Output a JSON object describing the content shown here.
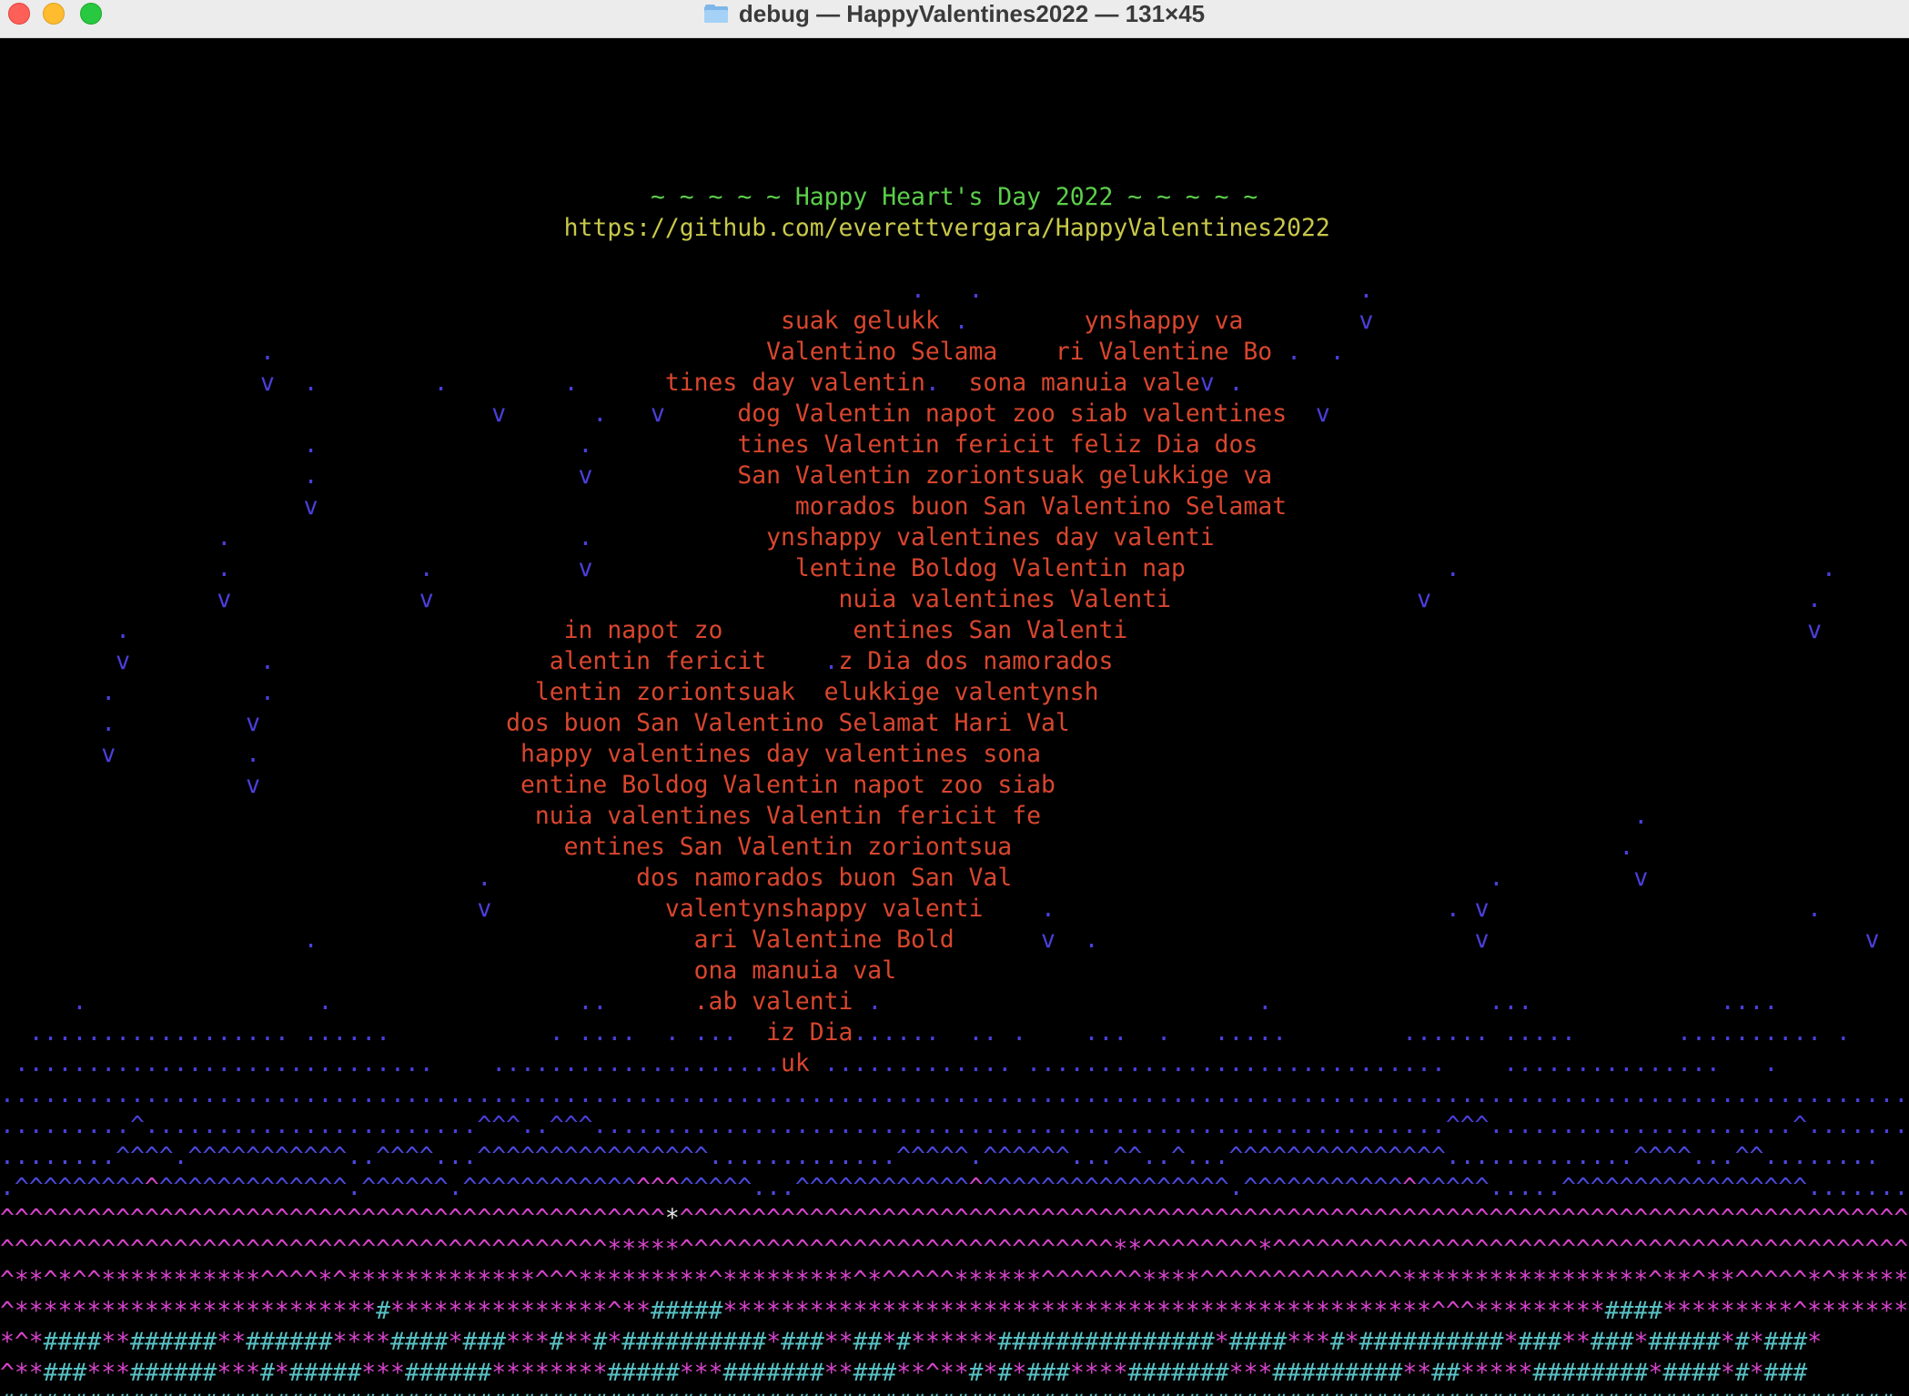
{
  "window": {
    "title": "debug — HappyValentines2022 — 131×45",
    "folder_icon": "folder-icon"
  },
  "colors": {
    "title": "#5ccf4a",
    "url": "#c8c84a",
    "heart": "#d9462e",
    "rain": "#4b3fdc",
    "caret": "#4d49de",
    "pink": "#d744cc",
    "hash": "#58c0c4",
    "white": "#e6e6e6"
  },
  "terminal": {
    "lines": [
      "",
      "",
      "",
      "",
      [
        [
          "                                             ~ ~ ~ ~ ~ Happy Heart's Day 2022 ~ ~ ~ ~ ~",
          "title"
        ]
      ],
      [
        [
          "                                       https://github.com/everettvergara/HappyValentines2022",
          "url"
        ]
      ],
      "",
      [
        [
          "                                                               .   .                          .",
          "rain"
        ]
      ],
      [
        [
          "                                                      suak gelukk ",
          "heart"
        ],
        [
          ".",
          "rain"
        ],
        [
          "        ynshappy va        ",
          "heart"
        ],
        [
          "v",
          "rain"
        ]
      ],
      [
        [
          "                  .",
          "rain"
        ],
        [
          "                                  Valentino Selama    ri Valentine Bo",
          "heart"
        ],
        [
          " .  .",
          "rain"
        ]
      ],
      [
        [
          "                  v  .        .        .",
          "rain"
        ],
        [
          "      tines day valentin",
          "heart"
        ],
        [
          ".",
          "rain"
        ],
        [
          "  sona manuia vale",
          "heart"
        ],
        [
          "v .",
          "rain"
        ]
      ],
      [
        [
          "                                  v      .   v",
          "rain"
        ],
        [
          "     dog Valentin napot zoo siab valentines",
          "heart"
        ],
        [
          "  v",
          "rain"
        ]
      ],
      [
        [
          "                     .                  .",
          "rain"
        ],
        [
          "          tines Valentin fericit feliz Dia dos",
          "heart"
        ]
      ],
      [
        [
          "                     .                  v",
          "rain"
        ],
        [
          "          San Valentin zoriontsuak gelukkige va",
          "heart"
        ]
      ],
      [
        [
          "                     v",
          "rain"
        ],
        [
          "                                 morados buon San Valentino Selamat",
          "heart"
        ]
      ],
      [
        [
          "               .                        .",
          "rain"
        ],
        [
          "            ynshappy valentines day valenti",
          "heart"
        ]
      ],
      [
        [
          "               .             .          v",
          "rain"
        ],
        [
          "              lentine Boldog Valentin nap",
          "heart"
        ],
        [
          "                  .                         .",
          "rain"
        ]
      ],
      [
        [
          "               v             v",
          "rain"
        ],
        [
          "                            nuia valentines Valenti",
          "heart"
        ],
        [
          "                 v                          .",
          "rain"
        ]
      ],
      [
        [
          "        .",
          "rain"
        ],
        [
          "                              in napot zo         entines San Valenti",
          "heart"
        ],
        [
          "                                               v",
          "rain"
        ]
      ],
      [
        [
          "        v         .",
          "rain"
        ],
        [
          "                   alentin fericit    ",
          "heart"
        ],
        [
          ".",
          "rain"
        ],
        [
          "z Dia dos namorados",
          "heart"
        ]
      ],
      [
        [
          "       .          .",
          "rain"
        ],
        [
          "                  lentin zoriontsuak  elukkige valentynsh",
          "heart"
        ]
      ],
      [
        [
          "       .         v",
          "rain"
        ],
        [
          "                 dos buon San Valentino Selamat Hari Val",
          "heart"
        ]
      ],
      [
        [
          "       v         .",
          "rain"
        ],
        [
          "                  happy valentines day valentines sona",
          "heart"
        ]
      ],
      [
        [
          "                 v",
          "rain"
        ],
        [
          "                  entine Boldog Valentin napot zoo siab",
          "heart"
        ]
      ],
      [
        [
          "                                     nuia valentines Valentin fericit fe",
          "heart"
        ],
        [
          "                                         .",
          "rain"
        ]
      ],
      [
        [
          "                                       entines San Valentin zoriontsua",
          "heart"
        ],
        [
          "                                          .",
          "rain"
        ]
      ],
      [
        [
          "                                 .",
          "rain"
        ],
        [
          "          dos namorados buon San Val",
          "heart"
        ],
        [
          "                                 .         v",
          "rain"
        ]
      ],
      [
        [
          "                                 v",
          "rain"
        ],
        [
          "            valentynshappy valenti",
          "heart"
        ],
        [
          "    .                           . v                      .",
          "rain"
        ]
      ],
      [
        [
          "                     .",
          "rain"
        ],
        [
          "                          ari Valentine Bold",
          "heart"
        ],
        [
          "      v  .                          v                          v",
          "rain"
        ]
      ],
      [
        [
          "                                                ona manuia val",
          "heart"
        ]
      ],
      [
        [
          "     .                .                 ..",
          "rain"
        ],
        [
          "      ",
          "rain"
        ],
        [
          ".ab valenti",
          "heart"
        ],
        [
          " .",
          "rain"
        ],
        [
          "                          .               ...             ....",
          "rain"
        ]
      ],
      [
        [
          "  .................. ......           . ....  . ...",
          "rain"
        ],
        [
          "  iz Dia",
          "heart"
        ],
        [
          "......  .. .    ...  .   .....        ...... .....       .......... .",
          "rain"
        ]
      ],
      [
        [
          " .............................    ....................",
          "rain"
        ],
        [
          "uk",
          "heart"
        ],
        [
          " ............. .............................    ...............   .",
          "rain"
        ]
      ],
      [
        [
          ".......................................................................................................................................",
          "rain"
        ]
      ],
      [
        [
          ".........^.......................^^^..^^^...........................................................^^^.....................^..............",
          "rain"
        ]
      ],
      [
        [
          "........^^^^.^^^^^^^^^^^..^^^^...^^^^^^^^^^^^^^^^.............^^^^^.^^^^^^...^^..^...^^^^^^^^^^^^^^^.............^^^^...^^........",
          "caret"
        ]
      ],
      [
        [
          ".^^^^^^^^^",
          "caret"
        ],
        [
          "^",
          "pink"
        ],
        [
          "^^^^^^^^^^^^^",
          "caret"
        ],
        [
          ".^^^^^^.^^^^^^^^^^^^",
          "caret"
        ],
        [
          "^^^",
          "pink"
        ],
        [
          "^^^^^...",
          "caret"
        ],
        [
          "^^^^^^^^^^^^",
          "caret"
        ],
        [
          "^",
          "pink"
        ],
        [
          "^^^^^^^^^^^^^^^^^.^^^^^^^^^^^",
          "caret"
        ],
        [
          "^",
          "pink"
        ],
        [
          "^^^^^.....^^^^^^^^^^^^^^^^^.......",
          "caret"
        ]
      ],
      [
        [
          "^^^^^^^^^^^^^^^^^^^^^^^^^^^^^^^^^^^^^^^^^^^^^^",
          "pink"
        ],
        [
          "*",
          "white"
        ],
        [
          "^^^^^^^^^^^^^^^^^^^^^^^^^^^^^^^^^^^^^^^^^^^^^^^^^^^^^^^^^^^^^^^^^^^^^^^^^^^^^^^^^^^^^^^",
          "pink"
        ]
      ],
      [
        [
          "^^^^^^^^^^^^^^^^^^^^^^^^^^^^^^^^^^^^^^^^^^",
          "pink"
        ],
        [
          "*****",
          "pink"
        ],
        [
          "^^^^^^^^^^^^^^^^^^^^^^^^^^^^^^**^^^^^^^^*^^^^^^^^^^^^^^^^^^^^^^^^^^^^^^^^^^^^^^^^^^^^^^^^^^^^^^",
          "pink"
        ]
      ],
      [
        [
          "^**^*^^***********^^^^*^*************^^^*********^*********^*^^^^^******^^^^^^^****^^^^^^^^^^^^^^*****************^**^**^^^^^*^*******^^",
          "pink"
        ]
      ],
      [
        [
          "^*************************",
          "pink"
        ],
        [
          "#",
          "hash"
        ],
        [
          "***************^**",
          "pink"
        ],
        [
          "#####",
          "hash"
        ],
        [
          "*************************************************^^^*********",
          "pink"
        ],
        [
          "####",
          "hash"
        ],
        [
          "*********^**********",
          "pink"
        ],
        [
          "##",
          "hash"
        ],
        [
          "*",
          "pink"
        ]
      ],
      [
        [
          "*^*",
          "pink"
        ],
        [
          "####",
          "hash"
        ],
        [
          "**",
          "pink"
        ],
        [
          "######",
          "hash"
        ],
        [
          "**",
          "pink"
        ],
        [
          "######",
          "hash"
        ],
        [
          "****",
          "pink"
        ],
        [
          "####",
          "hash"
        ],
        [
          "*",
          "pink"
        ],
        [
          "###",
          "hash"
        ],
        [
          "***",
          "pink"
        ],
        [
          "#",
          "hash"
        ],
        [
          "**",
          "pink"
        ],
        [
          "#",
          "hash"
        ],
        [
          "*",
          "pink"
        ],
        [
          "##########",
          "hash"
        ],
        [
          "*",
          "pink"
        ],
        [
          "###",
          "hash"
        ],
        [
          "**",
          "pink"
        ],
        [
          "##",
          "hash"
        ],
        [
          "*",
          "pink"
        ],
        [
          "#",
          "hash"
        ],
        [
          "******",
          "pink"
        ],
        [
          "###############",
          "hash"
        ],
        [
          "*",
          "pink"
        ],
        [
          "####",
          "hash"
        ],
        [
          "***",
          "pink"
        ],
        [
          "#",
          "hash"
        ],
        [
          "*",
          "pink"
        ],
        [
          "##########",
          "hash"
        ],
        [
          "*",
          "pink"
        ],
        [
          "###",
          "hash"
        ],
        [
          "**",
          "pink"
        ],
        [
          "###",
          "hash"
        ],
        [
          "*",
          "pink"
        ],
        [
          "#####",
          "hash"
        ],
        [
          "*",
          "pink"
        ],
        [
          "#",
          "hash"
        ],
        [
          "*",
          "pink"
        ],
        [
          "###",
          "hash"
        ],
        [
          "*",
          "pink"
        ]
      ],
      [
        [
          "^**",
          "pink"
        ],
        [
          "###",
          "hash"
        ],
        [
          "***",
          "pink"
        ],
        [
          "######",
          "hash"
        ],
        [
          "***",
          "pink"
        ],
        [
          "#",
          "hash"
        ],
        [
          "*",
          "pink"
        ],
        [
          "#####",
          "hash"
        ],
        [
          "***",
          "pink"
        ],
        [
          "######",
          "hash"
        ],
        [
          "********",
          "pink"
        ],
        [
          "#####",
          "hash"
        ],
        [
          "***",
          "pink"
        ],
        [
          "#######",
          "hash"
        ],
        [
          "**",
          "pink"
        ],
        [
          "###",
          "hash"
        ],
        [
          "**^**",
          "pink"
        ],
        [
          "#",
          "hash"
        ],
        [
          "*",
          "pink"
        ],
        [
          "#",
          "hash"
        ],
        [
          "*",
          "pink"
        ],
        [
          "###",
          "hash"
        ],
        [
          "****",
          "pink"
        ],
        [
          "#######",
          "hash"
        ],
        [
          "***",
          "pink"
        ],
        [
          "#########",
          "hash"
        ],
        [
          "**",
          "pink"
        ],
        [
          "##",
          "hash"
        ],
        [
          "*****",
          "pink"
        ],
        [
          "########",
          "hash"
        ],
        [
          "*",
          "pink"
        ],
        [
          "####",
          "hash"
        ],
        [
          "*",
          "pink"
        ],
        [
          "#",
          "hash"
        ],
        [
          "*",
          "pink"
        ],
        [
          "###",
          "hash"
        ]
      ],
      [
        [
          "###################################################################################################################################",
          "hash"
        ]
      ]
    ]
  }
}
